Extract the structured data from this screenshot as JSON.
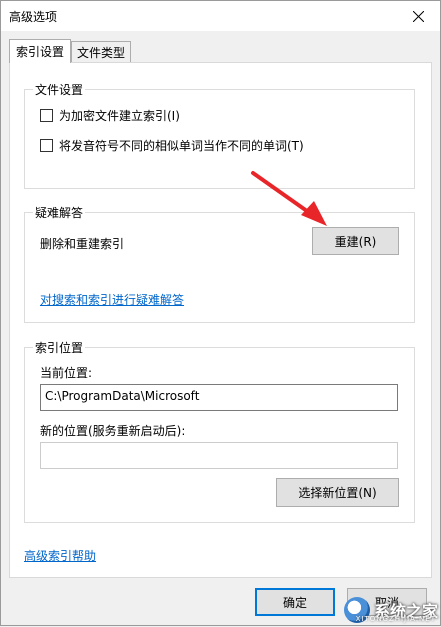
{
  "window": {
    "title": "高级选项"
  },
  "tabs": [
    {
      "label": "索引设置",
      "active": true
    },
    {
      "label": "文件类型",
      "active": false
    }
  ],
  "file_settings": {
    "title": "文件设置",
    "options": [
      {
        "label": "为加密文件建立索引(I)",
        "checked": false
      },
      {
        "label": "将发音符号不同的相似单词当作不同的单词(T)",
        "checked": false
      }
    ]
  },
  "troubleshoot": {
    "title": "疑难解答",
    "rebuild_label": "删除和重建索引",
    "rebuild_button": "重建(R)",
    "link": "对搜索和索引进行疑难解答"
  },
  "index_location": {
    "title": "索引位置",
    "current_label": "当前位置:",
    "current_value": "C:\\ProgramData\\Microsoft",
    "new_label": "新的位置(服务重新启动后):",
    "new_value": "",
    "select_button": "选择新位置(N)"
  },
  "footer": {
    "help_link": "高级索引帮助",
    "ok_button": "确定",
    "cancel_button": "取消"
  },
  "watermark": {
    "text": "系统之家",
    "sub": "XITONGZHIJIA.NET"
  },
  "colors": {
    "accent_link": "#0066cc",
    "arrow": "#e8262a"
  }
}
